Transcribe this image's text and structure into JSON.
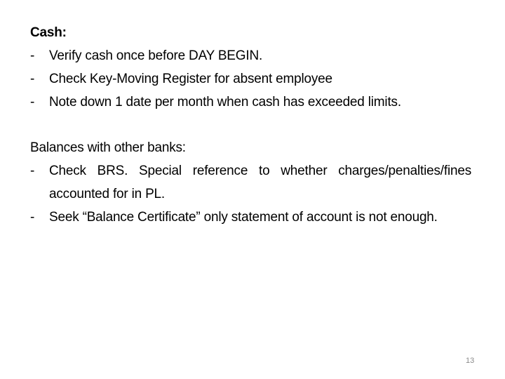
{
  "slide": {
    "sections": [
      {
        "heading": "Cash:",
        "items": [
          "Verify cash once before DAY BEGIN.",
          "Check Key-Moving Register for absent employee",
          "Note down 1 date per month when cash has exceeded limits."
        ]
      },
      {
        "heading": "Balances with other banks:",
        "items": [
          "Check BRS. Special reference to whether charges/penalties/fines accounted for in PL.",
          "Seek “Balance Certificate” only statement of account is not enough."
        ]
      }
    ],
    "bullet": "-",
    "page_number": "13"
  }
}
